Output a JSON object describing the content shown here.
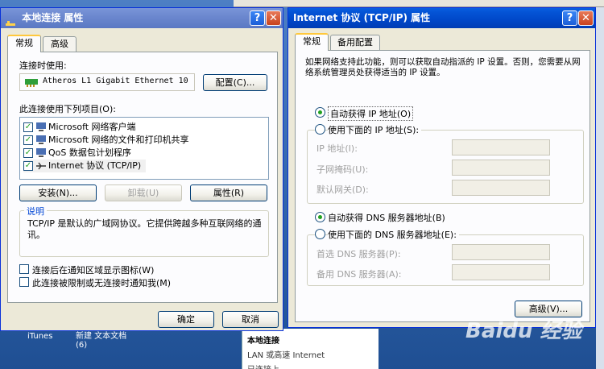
{
  "desktop": {
    "icons": [
      "iTunes",
      "新建 文本文档 (6)"
    ],
    "bottom_panel": [
      "本地连接",
      "LAN 或高速 Internet",
      "已连接上"
    ]
  },
  "left_window": {
    "title": "本地连接 属性",
    "help_button": "?",
    "close_button": "✕",
    "tabs": [
      "常规",
      "高级"
    ],
    "connect_using_label": "连接时使用:",
    "adapter_name": "Atheros L1 Gigabit Ethernet 10",
    "configure_button": "配置(C)...",
    "items_label": "此连接使用下列项目(O):",
    "items": [
      {
        "label": "Microsoft 网络客户端",
        "checked": true
      },
      {
        "label": "Microsoft 网络的文件和打印机共享",
        "checked": true
      },
      {
        "label": "QoS 数据包计划程序",
        "checked": true
      },
      {
        "label": "Internet 协议 (TCP/IP)",
        "checked": true
      }
    ],
    "install_button": "安装(N)...",
    "uninstall_button": "卸载(U)",
    "properties_button": "属性(R)",
    "description_title": "说明",
    "description_text": "TCP/IP 是默认的广域网协议。它提供跨越多种互联网络的通讯。",
    "checkbox_notify_icon": "连接后在通知区域显示图标(W)",
    "checkbox_notify_limited": "此连接被限制或无连接时通知我(M)",
    "ok_button": "确定",
    "cancel_button": "取消"
  },
  "right_window": {
    "title": "Internet 协议 (TCP/IP) 属性",
    "help_button": "?",
    "close_button": "✕",
    "tabs": [
      "常规",
      "备用配置"
    ],
    "intro_text": "如果网络支持此功能，则可以获取自动指派的 IP 设置。否则，您需要从网络系统管理员处获得适当的 IP 设置。",
    "auto_ip": "自动获得 IP 地址(O)",
    "manual_ip": "使用下面的 IP 地址(S):",
    "ip_address_label": "IP 地址(I):",
    "subnet_label": "子网掩码(U):",
    "gateway_label": "默认网关(D):",
    "auto_dns": "自动获得 DNS 服务器地址(B)",
    "manual_dns": "使用下面的 DNS 服务器地址(E):",
    "preferred_dns_label": "首选 DNS 服务器(P):",
    "alternate_dns_label": "备用 DNS 服务器(A):",
    "advanced_button": "高级(V)...",
    "selected_ip_mode": "auto",
    "selected_dns_mode": "auto"
  },
  "watermark": "Baidu 经验",
  "colors": {
    "titlebar": "#0047c8",
    "window_bg": "#ece9d8",
    "tab_highlight": "#ffc83c",
    "radio_dot": "#21a121"
  }
}
